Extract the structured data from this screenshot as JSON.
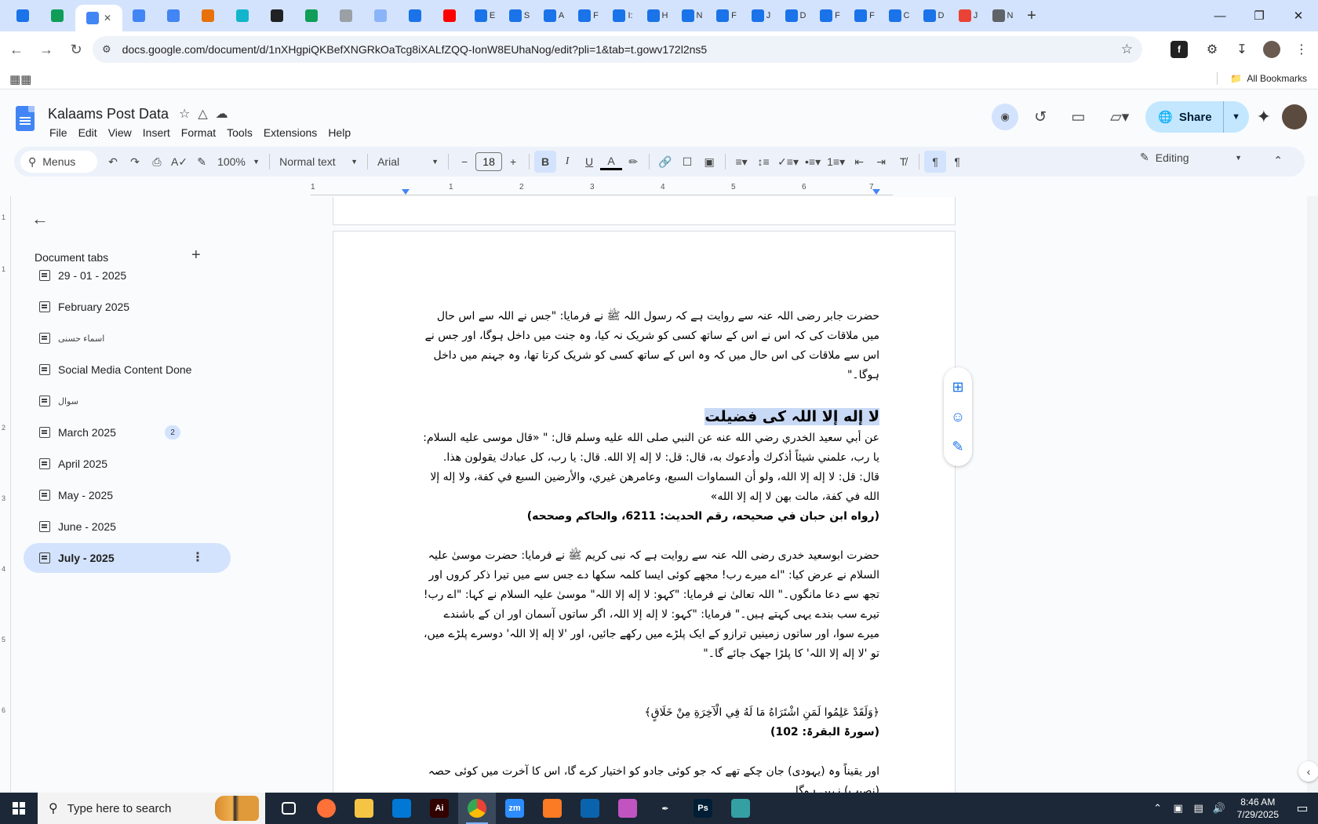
{
  "browser": {
    "tabs": [
      {
        "label": "",
        "color": "#1a73e8",
        "icon": "shield-icon"
      },
      {
        "label": "",
        "color": "#0f9d58",
        "icon": "sheets-icon"
      },
      {
        "label": "",
        "color": "#4285f4",
        "icon": "docs-icon",
        "active": true
      },
      {
        "label": "",
        "color": "#4285f4",
        "icon": "docs-icon"
      },
      {
        "label": "",
        "color": "#4285f4",
        "icon": "docs-icon"
      },
      {
        "label": "",
        "color": "#e8710a",
        "icon": "puzzle-icon"
      },
      {
        "label": "",
        "color": "#12b5cb",
        "icon": "diamond-icon"
      },
      {
        "label": "",
        "color": "#202124",
        "icon": "openai-icon"
      },
      {
        "label": "",
        "color": "#0f9d58",
        "icon": "sheets-icon"
      },
      {
        "label": "",
        "color": "#9aa0a6",
        "icon": "globe-icon"
      },
      {
        "label": "",
        "color": "#8ab4f8",
        "icon": "grid-icon"
      },
      {
        "label": "",
        "color": "#1a73e8",
        "icon": "form-icon"
      },
      {
        "label": "",
        "color": "#ff0000",
        "icon": "youtube-icon"
      },
      {
        "label": "E",
        "color": "#1a73e8",
        "icon": "form-icon"
      },
      {
        "label": "S",
        "color": "#1a73e8",
        "icon": "form-icon"
      },
      {
        "label": "A",
        "color": "#1a73e8",
        "icon": "form-icon"
      },
      {
        "label": "F",
        "color": "#1a73e8",
        "icon": "form-icon"
      },
      {
        "label": "I:",
        "color": "#1a73e8",
        "icon": "form-icon"
      },
      {
        "label": "H",
        "color": "#1a73e8",
        "icon": "form-icon"
      },
      {
        "label": "N",
        "color": "#1a73e8",
        "icon": "form-icon"
      },
      {
        "label": "F",
        "color": "#1a73e8",
        "icon": "form-icon"
      },
      {
        "label": "J",
        "color": "#1a73e8",
        "icon": "form-icon"
      },
      {
        "label": "D",
        "color": "#1a73e8",
        "icon": "form-icon"
      },
      {
        "label": "F",
        "color": "#1a73e8",
        "icon": "form-icon"
      },
      {
        "label": "F",
        "color": "#1a73e8",
        "icon": "form-icon"
      },
      {
        "label": "C",
        "color": "#1a73e8",
        "icon": "form-icon"
      },
      {
        "label": "D",
        "color": "#1a73e8",
        "icon": "form-icon"
      },
      {
        "label": "J",
        "color": "#ea4335",
        "icon": "google-icon"
      },
      {
        "label": "N",
        "color": "#5f6368",
        "icon": "chrome-icon"
      }
    ],
    "url": "docs.google.com/document/d/1nXHgpiQKBefXNGRkOaTcg8iXALfZQQ-IonW8EUhaNog/edit?pli=1&tab=t.gowv172l2ns5",
    "all_bookmarks": "All Bookmarks"
  },
  "docs": {
    "title": "Kalaams Post Data",
    "menu": [
      "File",
      "Edit",
      "View",
      "Insert",
      "Format",
      "Tools",
      "Extensions",
      "Help"
    ],
    "share_label": "Share"
  },
  "toolbar": {
    "menus_label": "Menus",
    "zoom": "100%",
    "style": "Normal text",
    "font": "Arial",
    "font_size": "18",
    "editing": "Editing"
  },
  "ruler": [
    "1",
    "1",
    "2",
    "3",
    "4",
    "5",
    "6",
    "7"
  ],
  "vruler": [
    "1",
    "1",
    "2",
    "3",
    "4",
    "5",
    "6"
  ],
  "sidebar": {
    "heading": "Document tabs",
    "tabs": [
      {
        "label": "29 - 01 - 2025"
      },
      {
        "label": "February 2025"
      },
      {
        "label": "اسماء حسنی",
        "small": true
      },
      {
        "label": "Social Media Content Done"
      },
      {
        "label": "سوال",
        "small": true
      },
      {
        "label": "March 2025",
        "badge": "2"
      },
      {
        "label": "April 2025"
      },
      {
        "label": "May - 2025"
      },
      {
        "label": "June - 2025"
      },
      {
        "label": "July - 2025",
        "active": true
      }
    ]
  },
  "document": {
    "para1": "حضرت جابر رضی اللہ عنہ سے روایت ہے کہ رسول اللہ ﷺ نے فرمایا: \"جس نے اللہ سے اس حال میں ملاقات کی کہ اس نے اس کے ساتھ کسی کو شریک نہ کیا، وہ جنت میں داخل ہوگا، اور جس نے اس سے ملاقات کی اس حال میں کہ وہ اس کے ساتھ کسی کو شریک کرتا تھا، وہ جہنم میں داخل ہوگا۔\"",
    "heading": "لا إله إلا اللہ کی فضیلت",
    "arabic_hadith": "عن أبي سعيد الخدري رضي الله عنه عن النبي صلى الله عليه وسلم قال: \" «قال موسى عليه السلام: يا رب، علمني شيئاً أذكرك وأدعوك به، قال: قل: لا إله إلا الله. قال: يا رب، كل عبادك يقولون هذا. قال: قل: لا إله إلا الله، ولو أن السماوات السبع، وعامرهن غيري، والأرضين السبع في كفة، ولا إله إلا الله في كفة، مالت بهن لا إله إلا الله»",
    "reference1": "(رواه ابن حبان في صحيحه، رقم الحديث: 6211، والحاكم وصححه)",
    "para2": "حضرت ابوسعید خدری رضی اللہ عنہ سے روایت ہے کہ نبی کریم ﷺ نے فرمایا: حضرت موسیٰ علیہ السلام نے عرض کیا: \"اے میرے رب! مجھے کوئی ایسا کلمہ سکھا دے جس سے میں تیرا ذکر کروں اور تجھ سے دعا مانگوں۔\" اللہ تعالیٰ نے فرمایا: \"کہو: لا إله إلا اللہ\" موسیٰ علیہ السلام نے کہا: \"اے رب! تیرے سب بندے یہی کہتے ہیں۔\" فرمایا: \"کہو: لا إله إلا اللہ، اگر ساتوں آسمان اور ان کے باشندے میرے سوا، اور ساتوں زمینیں ترازو کے ایک پلڑے میں رکھے جائیں، اور 'لا إله إلا اللہ' دوسرے پلڑے میں، تو 'لا إله إلا اللہ' کا پلڑا جھک جائے گا۔\"",
    "ayah": "﴿وَلَقَدْ عَلِمُوا لَمَنِ اشْتَرَاهُ مَا لَهُ فِي الْآخِرَةِ مِنْ خَلَاقٍ﴾",
    "reference2": "(سورۃ البقرۃ: 102)",
    "para3": "اور یقیناً وہ (یہودی) جان چکے تھے کہ جو کوئی جادو کو اختیار کرے گا، اس کا آخرت میں کوئی حصہ (نصیب) نہیں ہوگا۔"
  },
  "taskbar": {
    "search_placeholder": "Type here to search",
    "apps": [
      {
        "name": "task-view",
        "label": "",
        "color": "transparent"
      },
      {
        "name": "firefox",
        "label": "",
        "color": "#ff7139"
      },
      {
        "name": "file-explorer",
        "label": "",
        "color": "#f6c445"
      },
      {
        "name": "vscode",
        "label": "",
        "color": "#0078d4"
      },
      {
        "name": "illustrator",
        "label": "Ai",
        "color": "#330000"
      },
      {
        "name": "chrome",
        "label": "",
        "color": "#4285f4",
        "active": true
      },
      {
        "name": "zoom",
        "label": "zm",
        "color": "#2d8cff"
      },
      {
        "name": "xampp",
        "label": "",
        "color": "#fb7a24"
      },
      {
        "name": "outlook",
        "label": "",
        "color": "#0a64ad"
      },
      {
        "name": "paint",
        "label": "",
        "color": "#c154c1"
      },
      {
        "name": "pen-tool",
        "label": "",
        "color": "transparent"
      },
      {
        "name": "photoshop",
        "label": "Ps",
        "color": "#001e36"
      },
      {
        "name": "app-diamond",
        "label": "",
        "color": "#34a0a4"
      }
    ],
    "time": "8:46 AM",
    "date": "7/29/2025"
  }
}
